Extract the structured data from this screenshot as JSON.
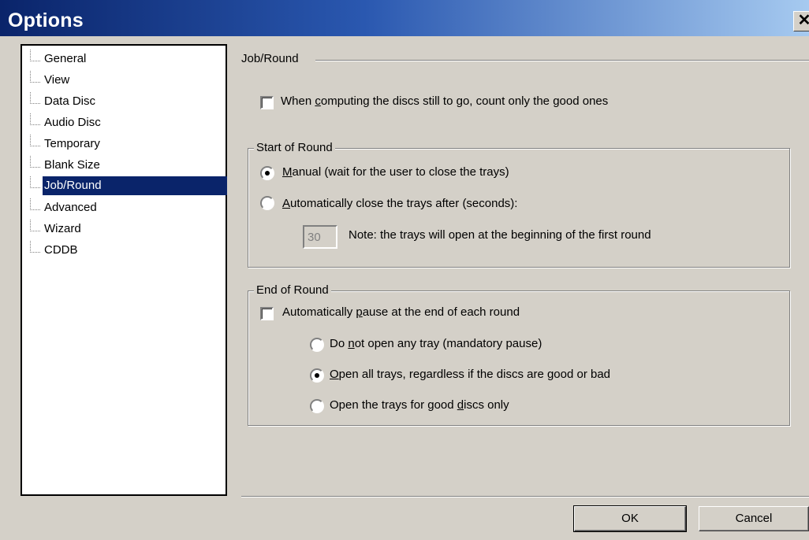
{
  "window": {
    "title": "Options",
    "close_label": "✕"
  },
  "tree": {
    "items": [
      {
        "label": "General"
      },
      {
        "label": "View"
      },
      {
        "label": "Data Disc"
      },
      {
        "label": "Audio Disc"
      },
      {
        "label": "Temporary"
      },
      {
        "label": "Blank Size"
      },
      {
        "label": "Job/Round"
      },
      {
        "label": "Advanced"
      },
      {
        "label": "Wizard"
      },
      {
        "label": "CDDB"
      }
    ],
    "selected_index": 6
  },
  "page": {
    "title": "Job/Round",
    "count_good": {
      "label_pre": "When ",
      "label_u": "c",
      "label_post": "omputing the discs still to go, count only the good ones",
      "checked": false
    },
    "start_of_round": {
      "title": "Start of Round",
      "manual": {
        "label_u": "M",
        "label_post": "anual (wait for the user to close the trays)",
        "selected": true
      },
      "auto": {
        "label_u": "A",
        "label_post": "utomatically close the trays after (seconds):",
        "selected": false
      },
      "seconds_value": "30",
      "note": "Note: the trays will open at the beginning of the first round"
    },
    "end_of_round": {
      "title": "End of Round",
      "auto_pause": {
        "label_pre": "Automatically ",
        "label_u": "p",
        "label_post": "ause at the end of each round",
        "checked": false
      },
      "options": [
        {
          "label_pre": "Do ",
          "label_u": "n",
          "label_post": "ot open any tray (mandatory pause)",
          "selected": false
        },
        {
          "label_pre": "",
          "label_u": "O",
          "label_post": "pen all trays, regardless if the discs are good or bad",
          "selected": true
        },
        {
          "label_pre": "Open the trays for good ",
          "label_u": "d",
          "label_post": "iscs only",
          "selected": false
        }
      ]
    }
  },
  "buttons": {
    "ok": "OK",
    "cancel": "Cancel"
  }
}
